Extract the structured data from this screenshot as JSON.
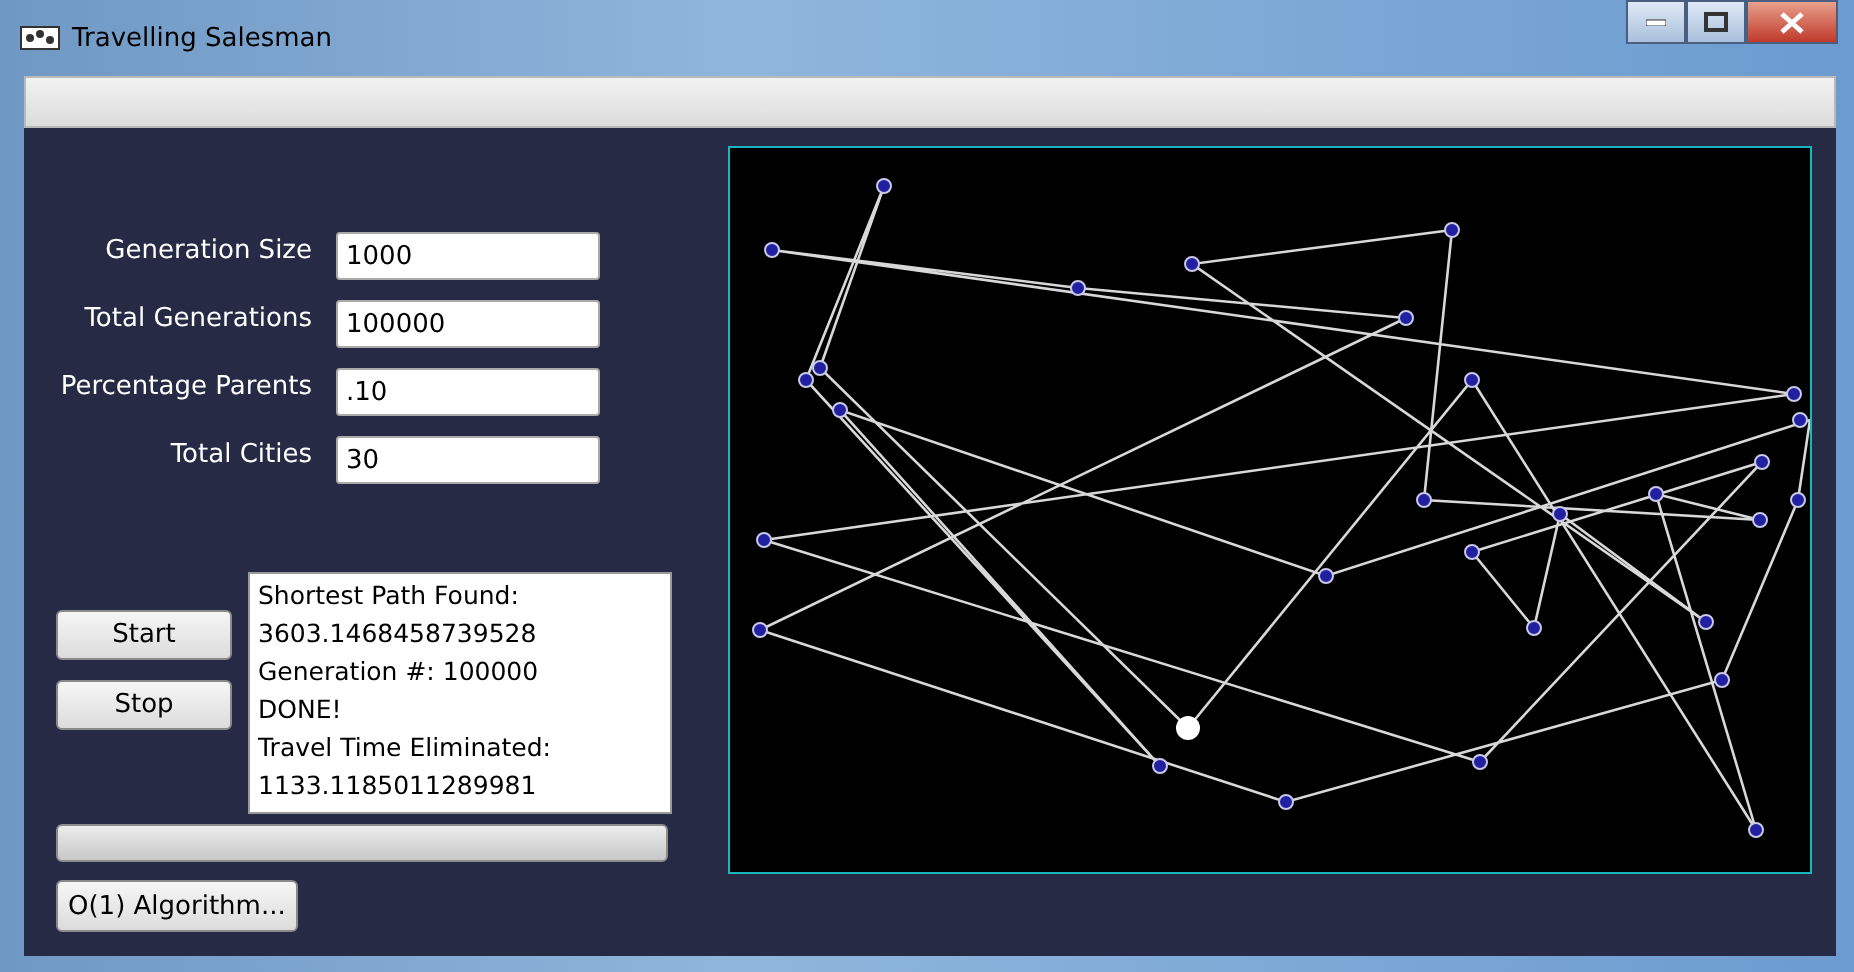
{
  "window": {
    "title": "Travelling Salesman"
  },
  "fields": [
    {
      "label": "Generation Size",
      "value": "1000"
    },
    {
      "label": "Total Generations",
      "value": "100000"
    },
    {
      "label": "Percentage Parents",
      "value": ".10"
    },
    {
      "label": "Total Cities",
      "value": "30"
    }
  ],
  "buttons": [
    {
      "label": "Start"
    },
    {
      "label": "Stop"
    }
  ],
  "output": [
    "Shortest Path Found:",
    "3603.1468458739528",
    "Generation #: 100000",
    "DONE!",
    "Travel Time Eliminated:",
    "1133.1185011289981"
  ],
  "progress": {
    "level": 0
  },
  "algorithm_button": {
    "label": "O(1) Algorithm..."
  }
}
